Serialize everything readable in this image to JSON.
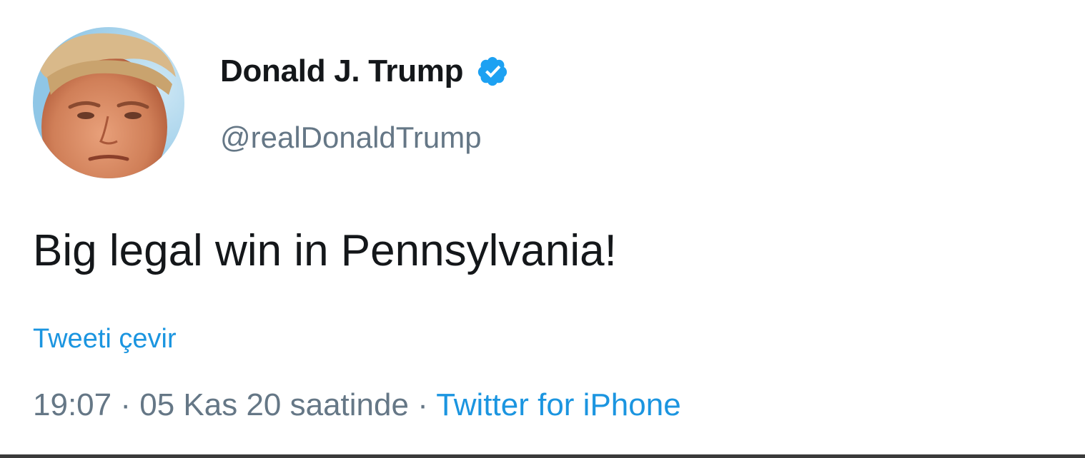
{
  "user": {
    "display_name": "Donald J. Trump",
    "handle": "@realDonaldTrump",
    "verified": true,
    "verified_color": "#1da1f2",
    "avatar_icon": "profile-photo"
  },
  "tweet": {
    "text": "Big legal win in Pennsylvania!",
    "translate_label": "Tweeti çevir"
  },
  "meta": {
    "time": "19:07",
    "separator": "·",
    "date": "05 Kas 20 saatinde",
    "source": "Twitter for iPhone"
  },
  "colors": {
    "text_primary": "#14171a",
    "text_secondary": "#657786",
    "link": "#1b95e0"
  }
}
